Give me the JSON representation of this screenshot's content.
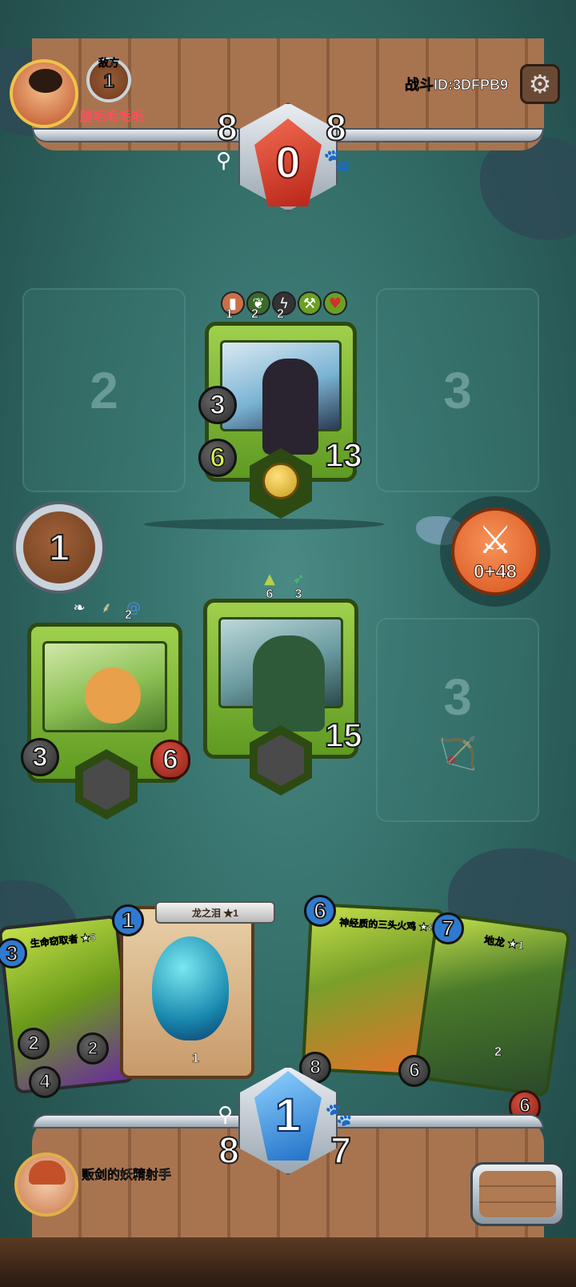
{
  "opponent": {
    "label": "敌方",
    "rank": "1",
    "name": "腿毛毛毛毛",
    "battle_id": "战斗ID:3DFPB9",
    "stat_left": "8",
    "stat_right": "8",
    "gem_value": "0"
  },
  "player": {
    "name": "贩剑的妖精射手",
    "stat_left": "8",
    "stat_right": "7",
    "gem_value": "1"
  },
  "board": {
    "round": "1",
    "attack_label": "0+48",
    "slots": [
      {
        "label": "2"
      },
      {
        "label": "3"
      },
      {
        "label": "3"
      }
    ]
  },
  "enemy_unit": {
    "top_icons": [
      {
        "icon": "card-icon",
        "value": "1"
      },
      {
        "icon": "leaf-icon",
        "value": "2"
      },
      {
        "icon": "lightning-icon",
        "value": "2"
      },
      {
        "icon": "axe-icon",
        "value": ""
      },
      {
        "icon": "heart-icon",
        "value": ""
      }
    ],
    "shield": "3",
    "attack": "6",
    "health": "13"
  },
  "ally_units": [
    {
      "top_icons": [
        {
          "icon": "feather-icon",
          "value": ""
        },
        {
          "icon": "wheat-icon",
          "value": ""
        },
        {
          "icon": "swirl-icon",
          "value": "2"
        }
      ],
      "shield": "3",
      "health": "6"
    },
    {
      "top_icons": [
        {
          "icon": "arrow-up-icon",
          "value": "6"
        },
        {
          "icon": "arrow-green-icon",
          "value": "3"
        }
      ],
      "health": "15"
    }
  ],
  "hand": [
    {
      "title": "生命窃取者 ★5",
      "cost": "3",
      "stat_a": "2",
      "stat_b": "4",
      "extra": "2"
    },
    {
      "title": "龙之泪 ★1",
      "cost": "1",
      "stat_a": "1"
    },
    {
      "title": "神经质的三头火鸡 ★8",
      "cost": "6",
      "stat_a": "8"
    },
    {
      "title": "地龙 ★1",
      "cost": "7",
      "stat_a": "6",
      "stat_b": "2",
      "health": "6"
    }
  ],
  "colors": {
    "card_green": "#7fb83a",
    "attack_orange": "#e8672a",
    "gem_red": "#d13b2b",
    "gem_blue": "#2f8fe0"
  }
}
